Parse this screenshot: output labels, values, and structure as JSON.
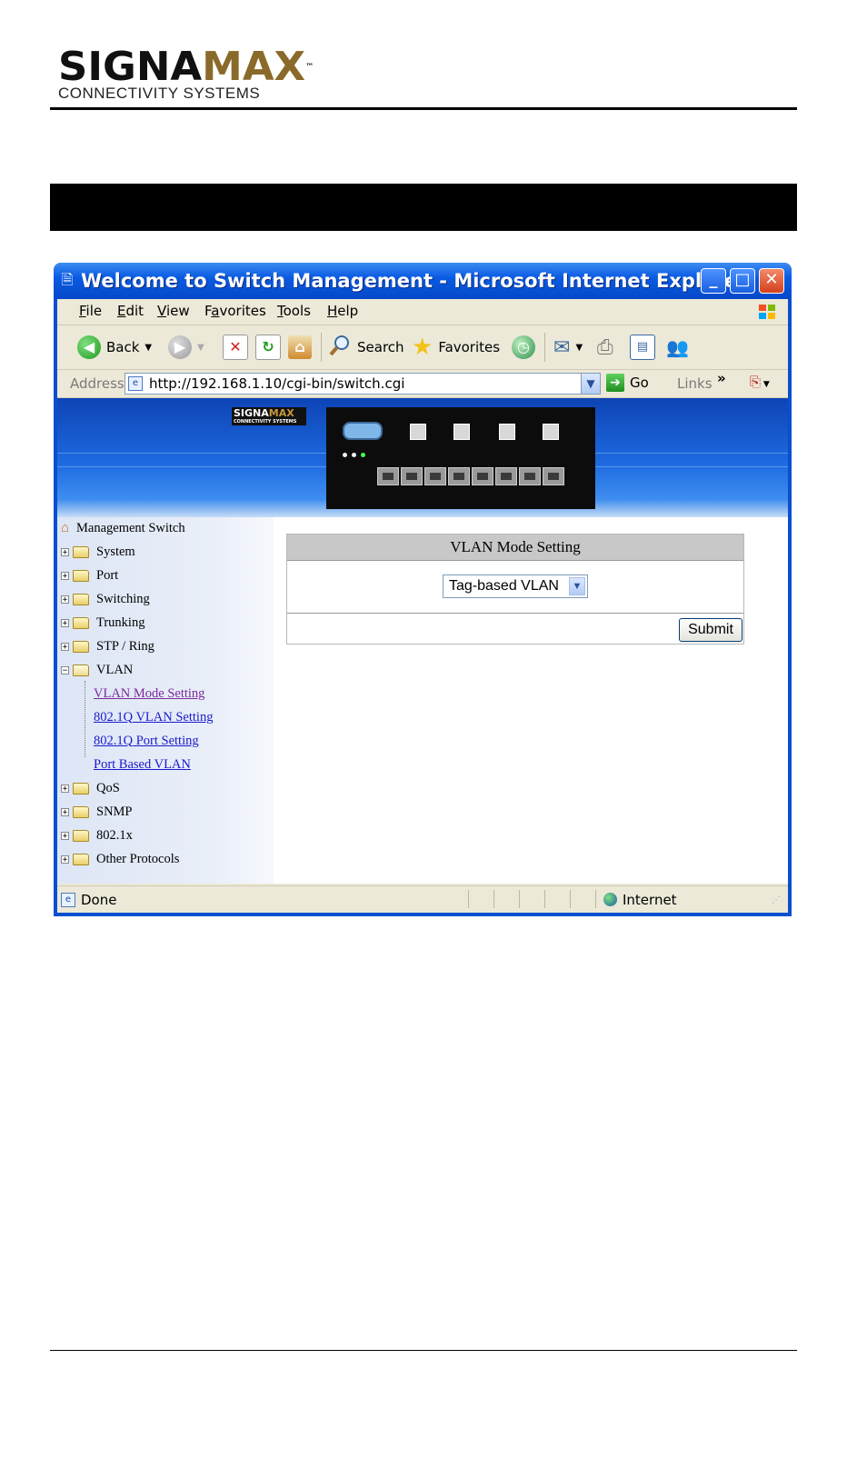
{
  "document": {
    "logo_brand_a": "SIGNA",
    "logo_brand_b": "MAX",
    "logo_tm": "™",
    "logo_subtitle": "CONNECTIVITY SYSTEMS"
  },
  "window": {
    "title": "Welcome to Switch Management - Microsoft Internet Explorer",
    "minimize": "_",
    "maximize": "□",
    "close": "✕"
  },
  "menu": {
    "items": [
      {
        "label": "File",
        "u": "F",
        "rest": "ile"
      },
      {
        "label": "Edit",
        "u": "E",
        "rest": "dit"
      },
      {
        "label": "View",
        "u": "V",
        "rest": "iew"
      },
      {
        "label": "Favorites",
        "pre": "F",
        "u": "a",
        "rest": "vorites"
      },
      {
        "label": "Tools",
        "u": "T",
        "rest": "ools"
      },
      {
        "label": "Help",
        "u": "H",
        "rest": "elp"
      }
    ]
  },
  "toolbar": {
    "back": "Back",
    "search": "Search",
    "favorites": "Favorites"
  },
  "addressbar": {
    "label": "Address",
    "url": "http://192.168.1.10/cgi-bin/switch.cgi",
    "go": "Go",
    "links": "Links",
    "links_more": "»"
  },
  "banner": {
    "logo_a": "SIGNA",
    "logo_b": "MAX",
    "logo_sub": "CONNECTIVITY SYSTEMS"
  },
  "sidebar": {
    "root": "Management Switch",
    "items": [
      {
        "label": "System",
        "state": "+"
      },
      {
        "label": "Port",
        "state": "+"
      },
      {
        "label": "Switching",
        "state": "+"
      },
      {
        "label": "Trunking",
        "state": "+"
      },
      {
        "label": "STP / Ring",
        "state": "+"
      },
      {
        "label": "VLAN",
        "state": "−"
      }
    ],
    "vlan_children": [
      "VLAN Mode Setting",
      "802.1Q VLAN Setting",
      "802.1Q Port Setting",
      "Port Based VLAN"
    ],
    "items_after": [
      {
        "label": "QoS",
        "state": "+"
      },
      {
        "label": "SNMP",
        "state": "+"
      },
      {
        "label": "802.1x",
        "state": "+"
      },
      {
        "label": "Other Protocols",
        "state": "+"
      }
    ]
  },
  "panel": {
    "title": "VLAN Mode Setting",
    "select_value": "Tag-based VLAN",
    "submit": "Submit"
  },
  "statusbar": {
    "left": "Done",
    "zone": "Internet"
  },
  "colors": {
    "title_blue": "#0a5be3",
    "link_blue": "#1a1acc",
    "link_visited": "#7a2a9a",
    "logo_gold": "#8a6a2a"
  }
}
